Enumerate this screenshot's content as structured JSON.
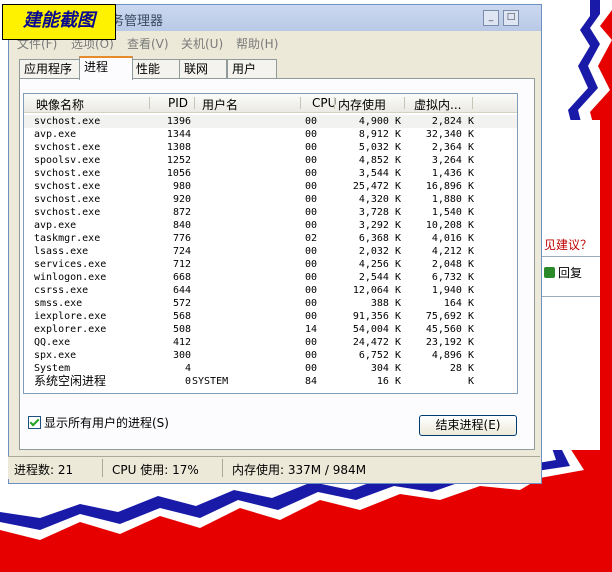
{
  "watermark": "建能截图",
  "window": {
    "title": "务管理器",
    "controls": {
      "minimize": "_",
      "maximize": "□"
    }
  },
  "menu": [
    "文件(F)",
    "选项(O)",
    "查看(V)",
    "关机(U)",
    "帮助(H)"
  ],
  "tabs": [
    {
      "label": "应用程序",
      "active": false
    },
    {
      "label": "进程",
      "active": true
    },
    {
      "label": "性能",
      "active": false
    },
    {
      "label": "联网",
      "active": false
    },
    {
      "label": "用户",
      "active": false
    }
  ],
  "table": {
    "headers": {
      "name": "映像名称",
      "pid": "PID",
      "user": "用户名",
      "cpu": "CPU",
      "mem": "内存使用",
      "virt": "虚拟内..."
    },
    "rows": [
      {
        "name": "svchost.exe",
        "pid": "1396",
        "user": "",
        "cpu": "00",
        "mem": "4,900 K",
        "virt": "2,824 K"
      },
      {
        "name": "avp.exe",
        "pid": "1344",
        "user": "",
        "cpu": "00",
        "mem": "8,912 K",
        "virt": "32,340 K"
      },
      {
        "name": "svchost.exe",
        "pid": "1308",
        "user": "",
        "cpu": "00",
        "mem": "5,032 K",
        "virt": "2,364 K"
      },
      {
        "name": "spoolsv.exe",
        "pid": "1252",
        "user": "",
        "cpu": "00",
        "mem": "4,852 K",
        "virt": "3,264 K"
      },
      {
        "name": "svchost.exe",
        "pid": "1056",
        "user": "",
        "cpu": "00",
        "mem": "3,544 K",
        "virt": "1,436 K"
      },
      {
        "name": "svchost.exe",
        "pid": "980",
        "user": "",
        "cpu": "00",
        "mem": "25,472 K",
        "virt": "16,896 K"
      },
      {
        "name": "svchost.exe",
        "pid": "920",
        "user": "",
        "cpu": "00",
        "mem": "4,320 K",
        "virt": "1,880 K"
      },
      {
        "name": "svchost.exe",
        "pid": "872",
        "user": "",
        "cpu": "00",
        "mem": "3,728 K",
        "virt": "1,540 K"
      },
      {
        "name": "avp.exe",
        "pid": "840",
        "user": "",
        "cpu": "00",
        "mem": "3,292 K",
        "virt": "10,208 K"
      },
      {
        "name": "taskmgr.exe",
        "pid": "776",
        "user": "",
        "cpu": "02",
        "mem": "6,368 K",
        "virt": "4,016 K"
      },
      {
        "name": "lsass.exe",
        "pid": "724",
        "user": "",
        "cpu": "00",
        "mem": "2,032 K",
        "virt": "4,212 K"
      },
      {
        "name": "services.exe",
        "pid": "712",
        "user": "",
        "cpu": "00",
        "mem": "4,256 K",
        "virt": "2,048 K"
      },
      {
        "name": "winlogon.exe",
        "pid": "668",
        "user": "",
        "cpu": "00",
        "mem": "2,544 K",
        "virt": "6,732 K"
      },
      {
        "name": "csrss.exe",
        "pid": "644",
        "user": "",
        "cpu": "00",
        "mem": "12,064 K",
        "virt": "1,940 K"
      },
      {
        "name": "smss.exe",
        "pid": "572",
        "user": "",
        "cpu": "00",
        "mem": "388 K",
        "virt": "164 K"
      },
      {
        "name": "iexplore.exe",
        "pid": "568",
        "user": "",
        "cpu": "00",
        "mem": "91,356 K",
        "virt": "75,692 K"
      },
      {
        "name": "explorer.exe",
        "pid": "508",
        "user": "",
        "cpu": "14",
        "mem": "54,004 K",
        "virt": "45,560 K"
      },
      {
        "name": "QQ.exe",
        "pid": "412",
        "user": "",
        "cpu": "00",
        "mem": "24,472 K",
        "virt": "23,192 K"
      },
      {
        "name": "spx.exe",
        "pid": "300",
        "user": "",
        "cpu": "00",
        "mem": "6,752 K",
        "virt": "4,896 K"
      },
      {
        "name": "System",
        "pid": "4",
        "user": "",
        "cpu": "00",
        "mem": "304 K",
        "virt": "28 K"
      },
      {
        "name": "系统空闲进程",
        "pid": "0",
        "user": "SYSTEM",
        "cpu": "84",
        "mem": "16 K",
        "virt": "K"
      }
    ]
  },
  "show_all_users": {
    "label": "显示所有用户的进程(S)",
    "checked": true
  },
  "end_process_button": "结束进程(E)",
  "status": {
    "processes": "进程数: 21",
    "cpu": "CPU 使用: 17%",
    "memory": "内存使用: 337M / 984M"
  },
  "background_page": {
    "suggestion_text": "见建议？",
    "reply_text": "回复"
  },
  "colors": {
    "background": "#e60000",
    "shadow": "#1a1aa8",
    "watermark_bg": "#fff200",
    "tab_highlight": "#e68b2c"
  }
}
